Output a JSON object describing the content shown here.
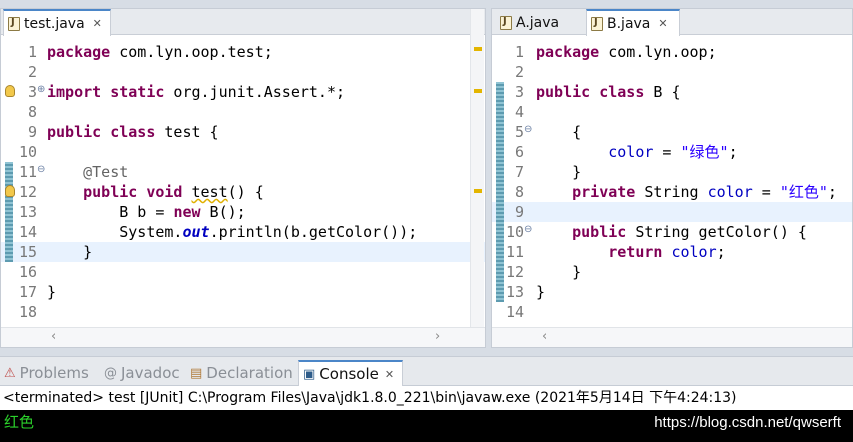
{
  "left_editor": {
    "tab": "test.java",
    "lines": [
      {
        "n": "1",
        "t": [
          {
            "k": "kw",
            "v": "package"
          },
          {
            "v": " com.lyn.oop.test;"
          }
        ]
      },
      {
        "n": "2",
        "t": []
      },
      {
        "n": "3",
        "t": [
          {
            "k": "kw",
            "v": "import static"
          },
          {
            "v": " org.junit.Assert.*;"
          }
        ]
      },
      {
        "n": "8",
        "t": []
      },
      {
        "n": "9",
        "t": [
          {
            "k": "kw",
            "v": "public class"
          },
          {
            "v": " test {"
          }
        ]
      },
      {
        "n": "10",
        "t": []
      },
      {
        "n": "11",
        "t": [
          {
            "v": "    "
          },
          {
            "k": "ann",
            "v": "@Test"
          }
        ]
      },
      {
        "n": "12",
        "t": [
          {
            "v": "    "
          },
          {
            "k": "kw",
            "v": "public void"
          },
          {
            "v": " "
          },
          {
            "k": "underline",
            "v": "test"
          },
          {
            "v": "() {"
          }
        ]
      },
      {
        "n": "13",
        "t": [
          {
            "v": "        B b = "
          },
          {
            "k": "kw",
            "v": "new"
          },
          {
            "v": " B();"
          }
        ]
      },
      {
        "n": "14",
        "t": [
          {
            "v": "        System."
          },
          {
            "k": "sfld",
            "v": "out"
          },
          {
            "v": ".println(b.getColor());"
          }
        ]
      },
      {
        "n": "15",
        "t": [
          {
            "v": "    }"
          }
        ]
      },
      {
        "n": "16",
        "t": []
      },
      {
        "n": "17",
        "t": [
          {
            "v": "}"
          }
        ]
      },
      {
        "n": "18",
        "t": []
      }
    ]
  },
  "right_editor": {
    "tabs": [
      "A.java",
      "B.java"
    ],
    "active_tab": "B.java",
    "lines": [
      {
        "n": "1",
        "t": [
          {
            "k": "kw",
            "v": "package"
          },
          {
            "v": " com.lyn.oop;"
          }
        ]
      },
      {
        "n": "2",
        "t": []
      },
      {
        "n": "3",
        "t": [
          {
            "k": "kw",
            "v": "public class"
          },
          {
            "v": " B {"
          }
        ]
      },
      {
        "n": "4",
        "t": []
      },
      {
        "n": "5",
        "t": [
          {
            "v": "    {"
          }
        ]
      },
      {
        "n": "6",
        "t": [
          {
            "v": "        "
          },
          {
            "k": "fld",
            "v": "color"
          },
          {
            "v": " = "
          },
          {
            "k": "str",
            "v": "\"绿色\""
          },
          {
            "v": ";"
          }
        ]
      },
      {
        "n": "7",
        "t": [
          {
            "v": "    }"
          }
        ]
      },
      {
        "n": "8",
        "t": [
          {
            "v": "    "
          },
          {
            "k": "kw",
            "v": "private"
          },
          {
            "v": " String "
          },
          {
            "k": "fld",
            "v": "color"
          },
          {
            "v": " = "
          },
          {
            "k": "str",
            "v": "\"红色\""
          },
          {
            "v": ";"
          }
        ]
      },
      {
        "n": "9",
        "t": []
      },
      {
        "n": "10",
        "t": [
          {
            "v": "    "
          },
          {
            "k": "kw",
            "v": "public"
          },
          {
            "v": " String getColor() {"
          }
        ]
      },
      {
        "n": "11",
        "t": [
          {
            "v": "        "
          },
          {
            "k": "kw",
            "v": "return"
          },
          {
            "v": " "
          },
          {
            "k": "fld",
            "v": "color"
          },
          {
            "v": ";"
          }
        ]
      },
      {
        "n": "12",
        "t": [
          {
            "v": "    }"
          }
        ]
      },
      {
        "n": "13",
        "t": [
          {
            "v": "}"
          }
        ]
      },
      {
        "n": "14",
        "t": []
      }
    ]
  },
  "bottom_panel": {
    "tabs": [
      {
        "label": "Problems",
        "icon": "problems-icon"
      },
      {
        "label": "Javadoc",
        "icon": "javadoc-icon"
      },
      {
        "label": "Declaration",
        "icon": "declaration-icon"
      },
      {
        "label": "Console",
        "icon": "console-icon",
        "active": true
      }
    ],
    "terminated_line": "<terminated> test [JUnit] C:\\Program Files\\Java\\jdk1.8.0_221\\bin\\javaw.exe (2021年5月14日 下午4:24:13)",
    "output": "红色",
    "watermark": "https://blog.csdn.net/qwserft"
  },
  "colors": {
    "keyword": "#7f0055",
    "field": "#0000c0",
    "string": "#2a00ff",
    "annotation": "#646464",
    "console_output": "#2bd12b"
  }
}
